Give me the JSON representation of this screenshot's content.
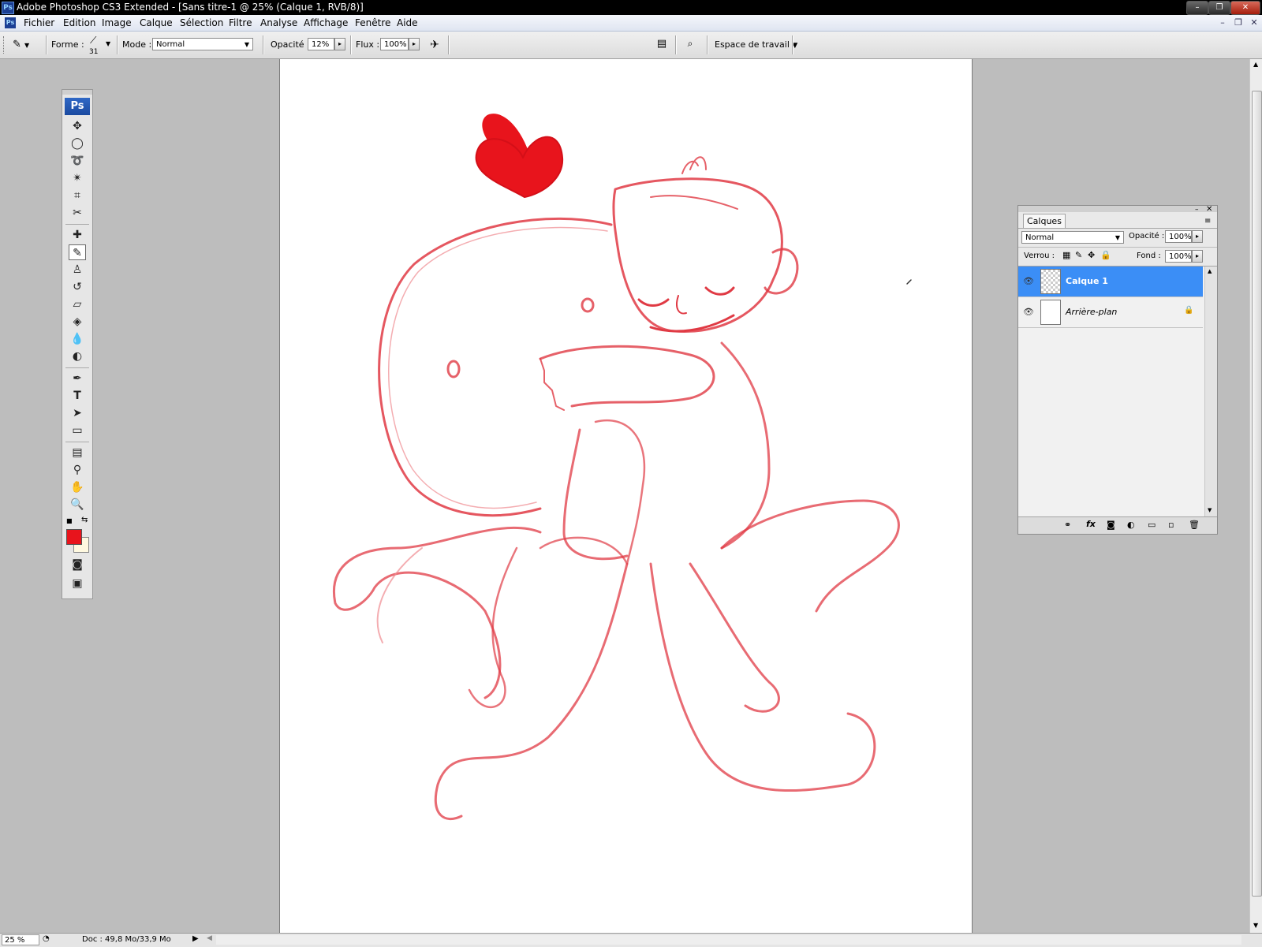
{
  "window": {
    "title": "Adobe Photoshop CS3 Extended - [Sans titre-1 @ 25% (Calque 1, RVB/8)]",
    "app_icon": "Ps"
  },
  "menu": [
    "Fichier",
    "Edition",
    "Image",
    "Calque",
    "Sélection",
    "Filtre",
    "Analyse",
    "Affichage",
    "Fenêtre",
    "Aide"
  ],
  "options": {
    "forme_label": "Forme :",
    "brush_size": "31",
    "mode_label": "Mode :",
    "mode_value": "Normal",
    "opacite_label": "Opacité :",
    "opacite_value": "12%",
    "flux_label": "Flux :",
    "flux_value": "100%",
    "workspace_label": "Espace de travail"
  },
  "toolbox": {
    "header": "Ps",
    "foreground_color": "#e8141c",
    "background_color": "#fff9e0"
  },
  "layers_panel": {
    "tab_label": "Calques",
    "blend_mode": "Normal",
    "opacite_label": "Opacité :",
    "opacite_value": "100%",
    "verrou_label": "Verrou :",
    "fond_label": "Fond :",
    "fond_value": "100%",
    "layers": [
      {
        "name": "Calque 1",
        "selected": true,
        "locked": false
      },
      {
        "name": "Arrière-plan",
        "selected": false,
        "locked": true
      }
    ]
  },
  "status": {
    "zoom": "25 %",
    "doc_info": "Doc : 49,8 Mo/33,9 Mo"
  },
  "colors": {
    "sketch_stroke": "#e03a44",
    "heart": "#e8141c",
    "selection_blue": "#3b8ef6"
  }
}
